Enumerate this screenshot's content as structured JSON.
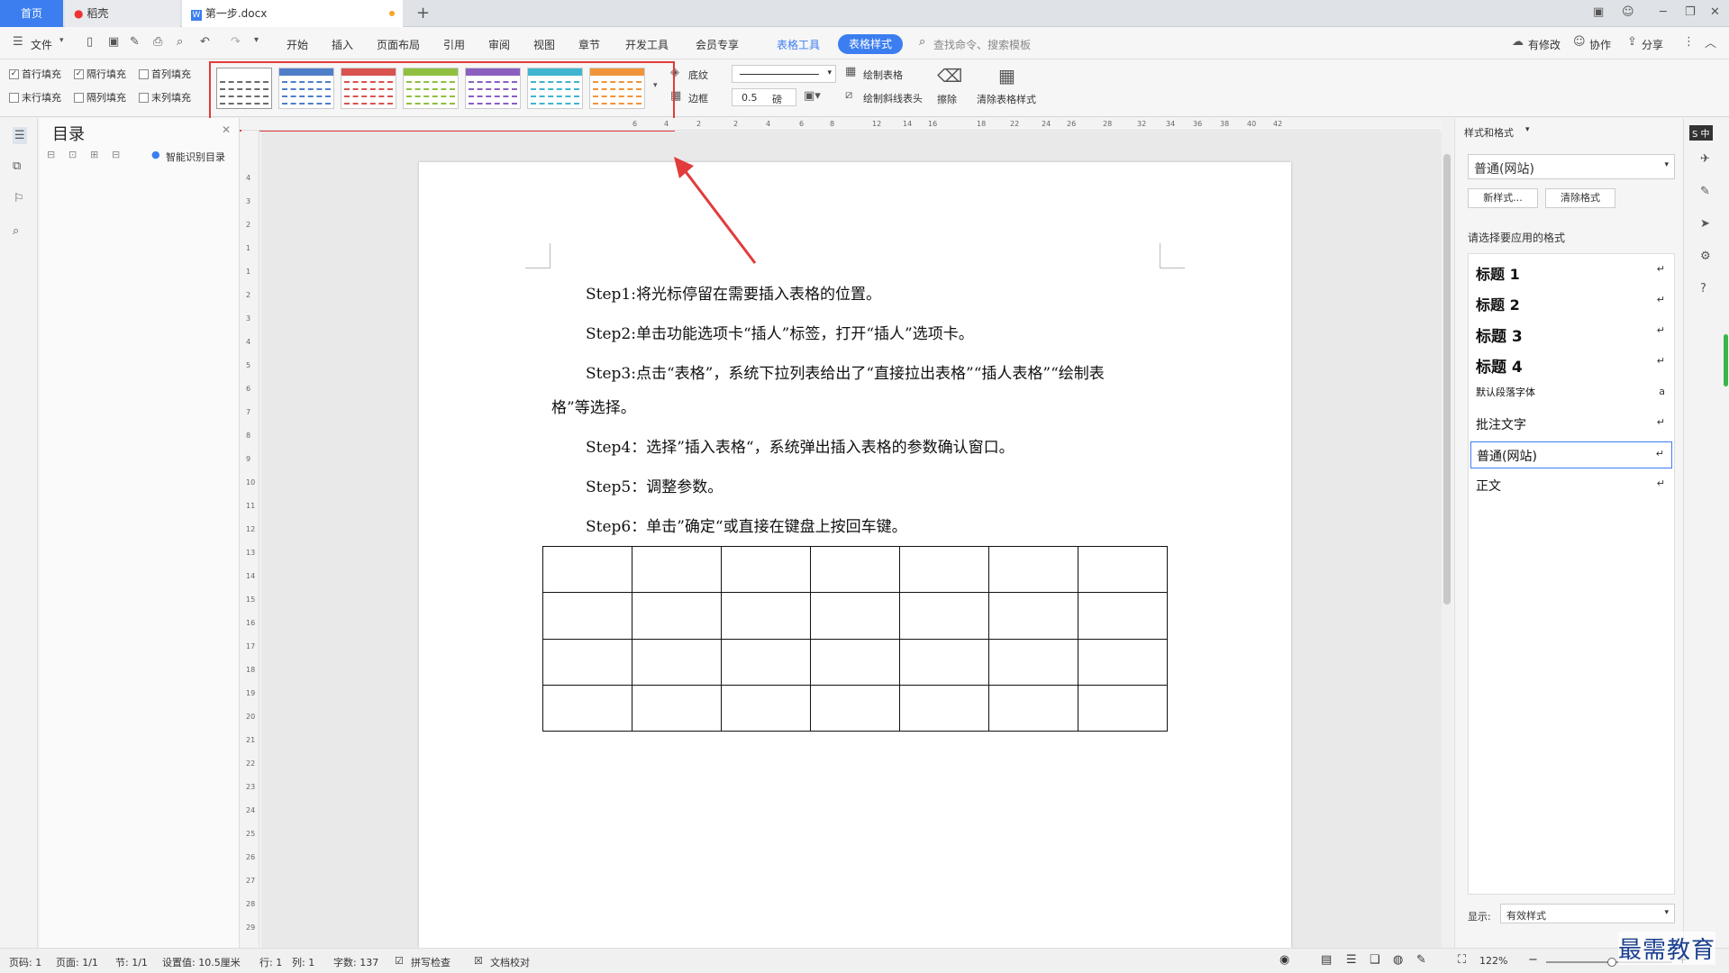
{
  "tabs": {
    "home": "首页",
    "daoke": "稻壳",
    "doc": "第一步.docx",
    "add": "+"
  },
  "menubar": {
    "file": "文件",
    "items": [
      "开始",
      "插入",
      "页面布局",
      "引用",
      "审阅",
      "视图",
      "章节",
      "开发工具",
      "会员专享"
    ],
    "table_tools": "表格工具",
    "table_style": "表格样式",
    "search": "查找命令、搜索模板",
    "modified": "有修改",
    "collab": "协作",
    "share": "分享"
  },
  "ribbon": {
    "options": [
      "首行填充",
      "隔行填充",
      "首列填充",
      "末行填充",
      "隔列填充",
      "末列填充"
    ],
    "shading": "底纹",
    "border": "边框",
    "line_width": "0.5",
    "unit": "磅",
    "draw_table": "绘制表格",
    "draw_diagonal": "绘制斜线表头",
    "erase": "擦除",
    "clear_style": "清除表格样式"
  },
  "style_colors": [
    "#6b6b6b",
    "#4f7ec9",
    "#d9534f",
    "#8fbf3f",
    "#8a5fbf",
    "#3fb5d0",
    "#f0943a"
  ],
  "toc": {
    "title": "目录",
    "smart": "智能识别目录"
  },
  "hruler": [
    "6",
    "4",
    "2",
    "2",
    "4",
    "6",
    "8",
    "12",
    "14",
    "16",
    "18",
    "22",
    "24",
    "26",
    "28",
    "32",
    "34",
    "36",
    "38",
    "40",
    "42"
  ],
  "vruler": [
    "4",
    "3",
    "2",
    "1",
    "1",
    "2",
    "3",
    "4",
    "5",
    "6",
    "7",
    "8",
    "9",
    "10",
    "11",
    "12",
    "13",
    "14",
    "15",
    "16",
    "17",
    "18",
    "19",
    "20",
    "21",
    "22",
    "23",
    "24",
    "25",
    "26",
    "27",
    "28",
    "29"
  ],
  "document": {
    "step1": "Step1:将光标停留在需要插入表格的位置。",
    "step2": "Step2:单击功能选项卡“插人”标签，打开“插人”选项卡。",
    "step3a": "Step3:点击“表格”，系统下拉列表给出了“直接拉出表格”“插人表格”“绘制表",
    "step3b": "格”等选择。",
    "step4": "Step4：选择”插入表格“，系统弹出插入表格的参数确认窗口。",
    "step5": "Step5：调整参数。",
    "step6": "Step6：单击”确定“或直接在键盘上按回车键。"
  },
  "right_panel": {
    "header": "样式和格式",
    "current": "普通(网站)",
    "new_style": "新样式...",
    "clear_format": "清除格式",
    "prompt": "请选择要应用的格式",
    "styles": [
      "标题  1",
      "标题  2",
      "标题  3",
      "标题  4",
      "默认段落字体",
      "批注文字",
      "普通(网站)",
      "正文"
    ],
    "show_label": "显示:",
    "show_value": "有效样式"
  },
  "status": {
    "page": "页码: 1",
    "pages": "页面: 1/1",
    "section": "节: 1/1",
    "setting": "设置值: 10.5厘米",
    "row": "行: 1",
    "col": "列: 1",
    "words": "字数: 137",
    "spell": "拼写检查",
    "proof": "文档校对",
    "zoom": "122%"
  },
  "watermark": "最需教育"
}
